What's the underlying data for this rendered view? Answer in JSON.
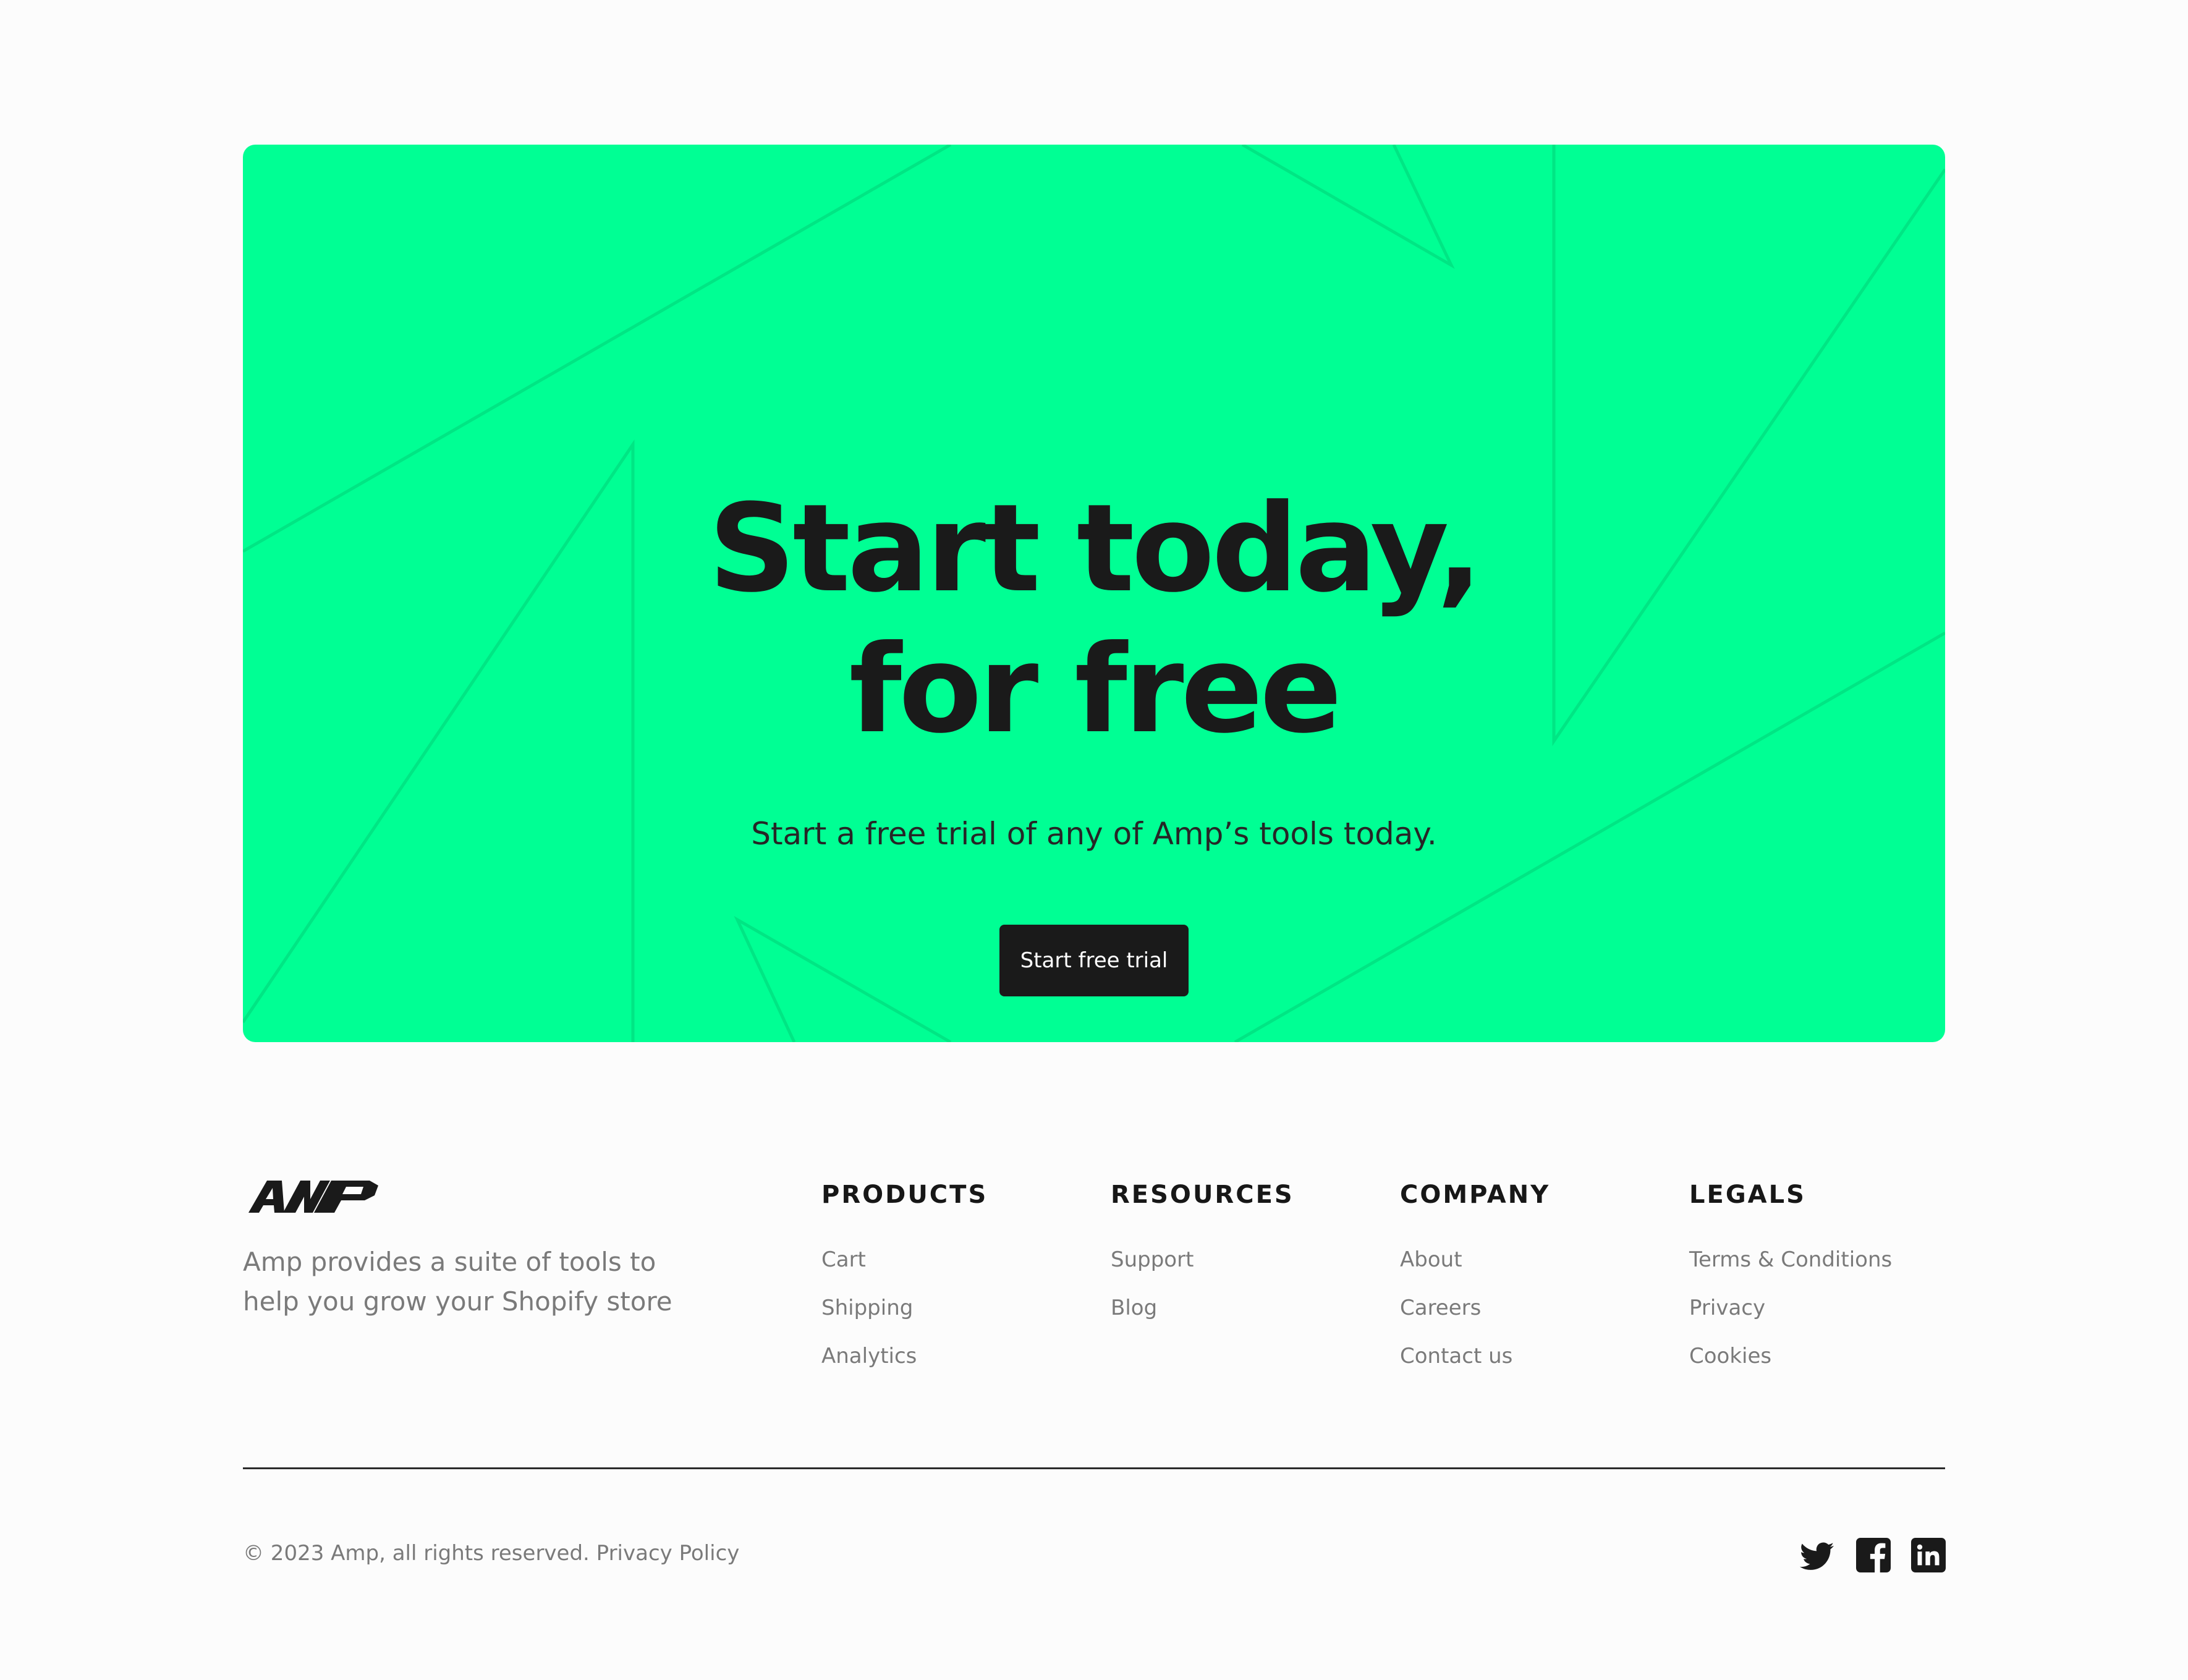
{
  "hero": {
    "title_line1": "Start today,",
    "title_line2": "for free",
    "subtitle": "Start a free trial of any of Amp’s tools today.",
    "cta_label": "Start free trial",
    "background": "#00ff94",
    "line_color": "#00e684"
  },
  "brand": {
    "logo_text": "AMP",
    "description": "Amp provides a suite of tools to help you grow your Shopify store"
  },
  "footer_columns": [
    {
      "heading": "PRODUCTS",
      "links": [
        "Cart",
        "Shipping",
        "Analytics"
      ]
    },
    {
      "heading": "RESOURCES",
      "links": [
        "Support",
        "Blog"
      ]
    },
    {
      "heading": "COMPANY",
      "links": [
        "About",
        "Careers",
        "Contact us"
      ]
    },
    {
      "heading": "LEGALS",
      "links": [
        "Terms & Conditions",
        "Privacy",
        "Cookies"
      ]
    }
  ],
  "bottom_bar": {
    "copyright": "© 2023 Amp, all rights reserved.",
    "privacy_link": "Privacy Policy"
  },
  "socials": [
    {
      "name": "twitter-icon"
    },
    {
      "name": "facebook-icon"
    },
    {
      "name": "linkedin-icon"
    }
  ],
  "colors": {
    "accent": "#00ff94",
    "text_dark": "#1a1a1a",
    "text_muted": "#7a7a7a",
    "page_bg": "#fcfcfc"
  }
}
